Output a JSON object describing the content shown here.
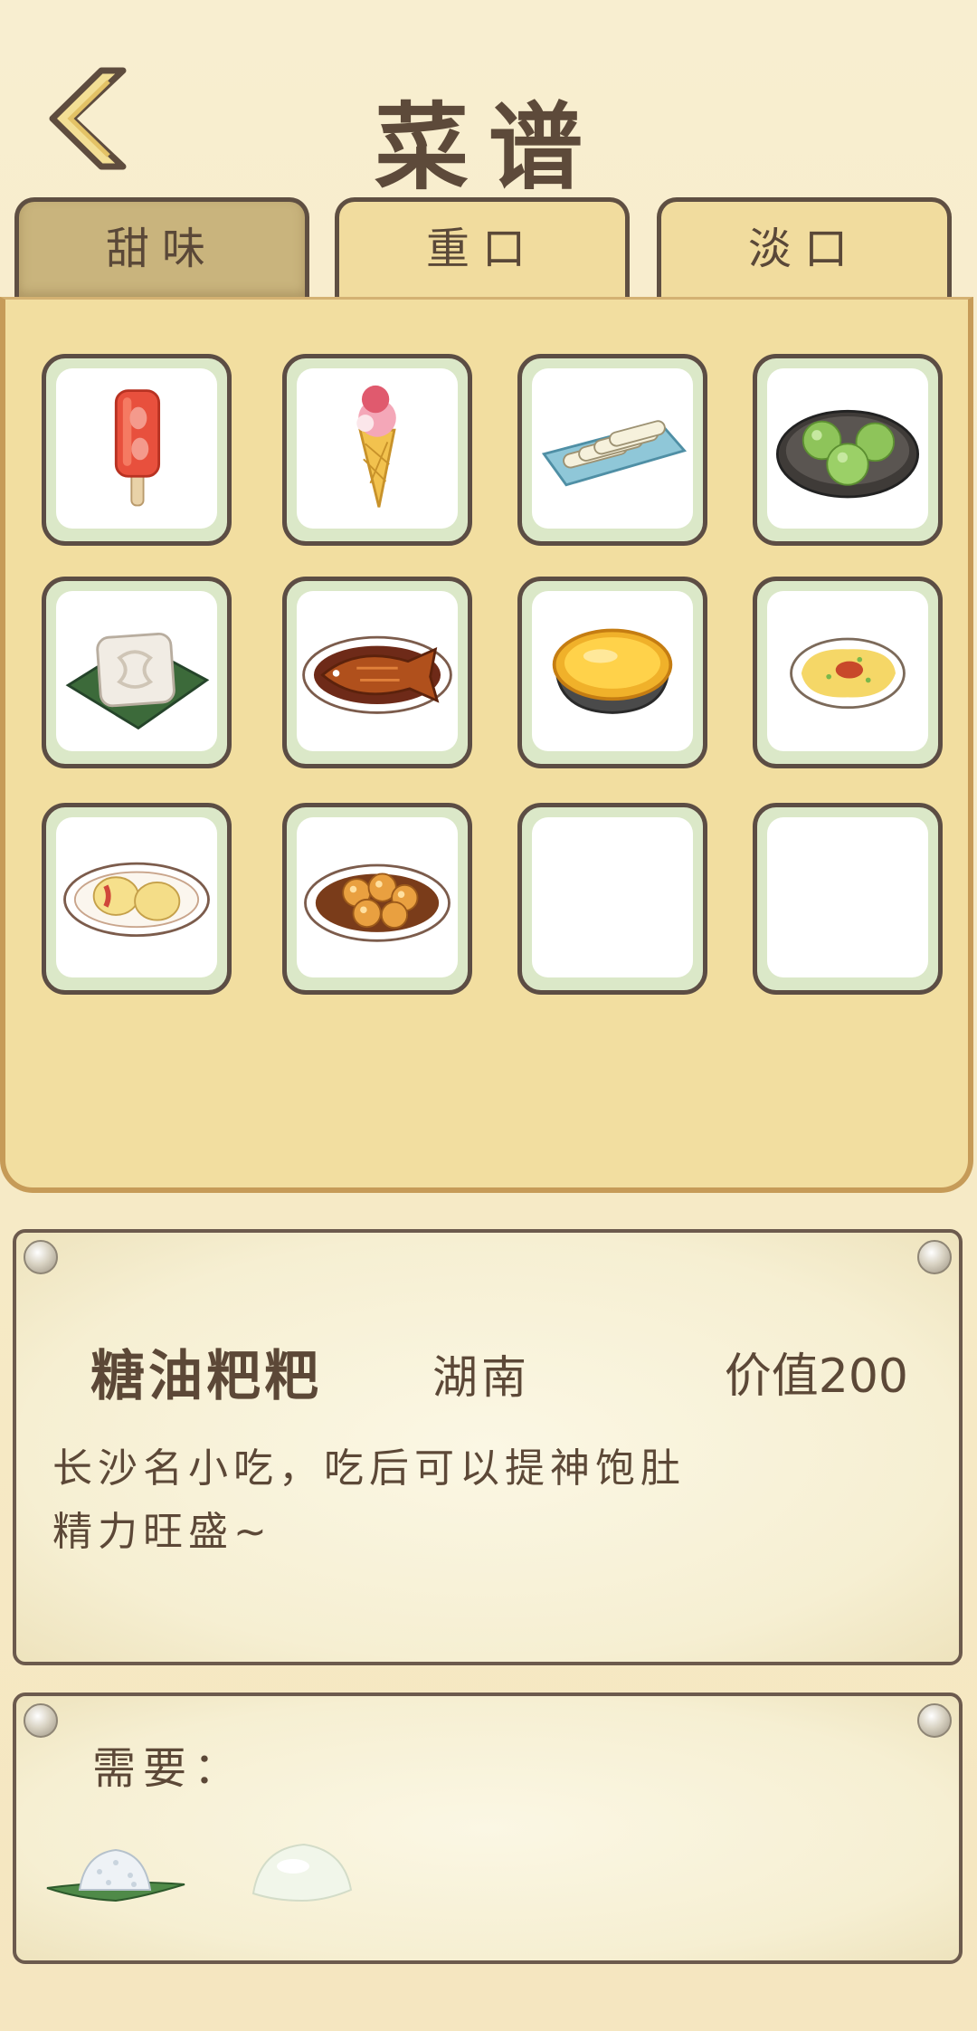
{
  "header": {
    "title": "菜谱",
    "back_icon": "chevron-left-icon"
  },
  "tabs": [
    {
      "label": "甜味",
      "active": true
    },
    {
      "label": "重口",
      "active": false
    },
    {
      "label": "淡口",
      "active": false
    }
  ],
  "recipes": [
    {
      "icon": "strawberry-popsicle-icon",
      "unlocked": true
    },
    {
      "icon": "ice-cream-cone-icon",
      "unlocked": true
    },
    {
      "icon": "rice-rolls-plate-icon",
      "unlocked": true
    },
    {
      "icon": "green-rice-balls-icon",
      "unlocked": true
    },
    {
      "icon": "square-rice-cake-icon",
      "unlocked": true
    },
    {
      "icon": "braised-fish-icon",
      "unlocked": true
    },
    {
      "icon": "egg-tart-icon",
      "unlocked": true
    },
    {
      "icon": "fried-egg-plate-icon",
      "unlocked": true
    },
    {
      "icon": "pastry-plate-icon",
      "unlocked": true
    },
    {
      "icon": "sugar-oil-cakes-icon",
      "unlocked": true
    },
    {
      "icon": "empty-slot",
      "unlocked": false
    },
    {
      "icon": "empty-slot",
      "unlocked": false
    }
  ],
  "detail": {
    "name": "糖油粑粑",
    "region": "湖南",
    "value": "价值200",
    "description_line1": "长沙名小吃，吃后可以提神饱肚",
    "description_line2": "精力旺盛~"
  },
  "requirements": {
    "label": "需要：",
    "ingredients": [
      {
        "icon": "sticky-rice-icon"
      },
      {
        "icon": "flour-dough-icon"
      }
    ]
  },
  "colors": {
    "background": "#f7ecc8",
    "panel": "#f2dea0",
    "active_tab": "#c9b47d",
    "card_border": "#5c4d44",
    "text": "#5c4837"
  }
}
